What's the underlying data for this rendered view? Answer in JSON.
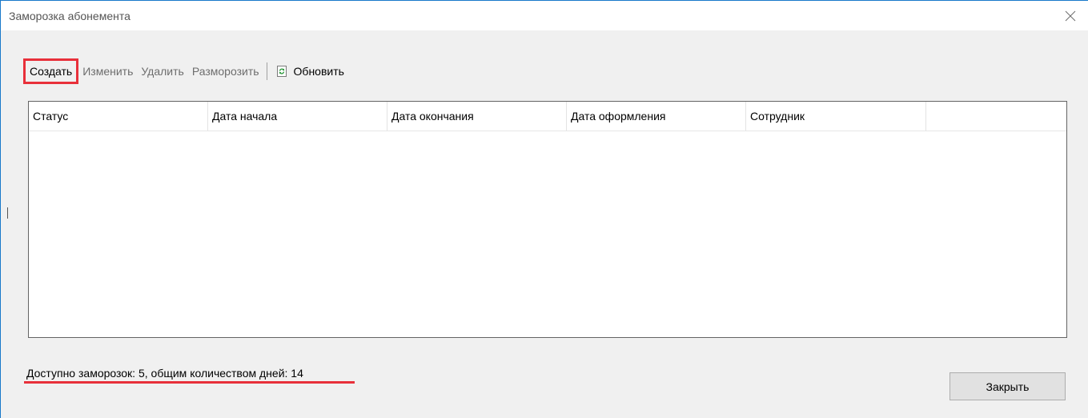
{
  "window": {
    "title": "Заморозка абонемента",
    "close_icon": "close-icon"
  },
  "toolbar": {
    "create_label": "Создать",
    "edit_label": "Изменить",
    "delete_label": "Удалить",
    "unfreeze_label": "Разморозить",
    "refresh_label": "Обновить",
    "refresh_icon": "refresh-icon",
    "highlight_color": "#e8303a"
  },
  "table": {
    "columns": [
      "Статус",
      "Дата начала",
      "Дата окончания",
      "Дата оформления",
      "Сотрудник",
      ""
    ],
    "rows": []
  },
  "footer": {
    "summary": "Доступно заморозок: 5, общим количеством дней: 14",
    "close_label": "Закрыть"
  },
  "colors": {
    "window_border": "#1979ca",
    "annotation_red": "#e8303a"
  }
}
